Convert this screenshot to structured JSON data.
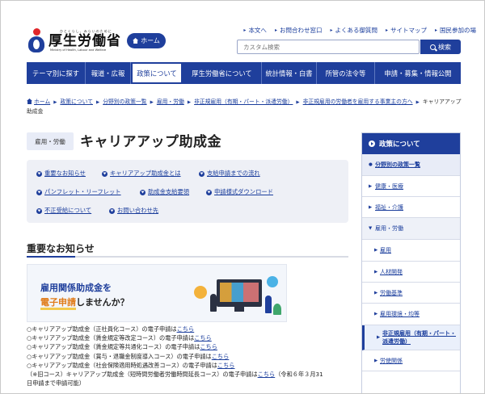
{
  "header": {
    "logo_ruby": "ひとくらし、みらいのために",
    "logo_name": "厚生労働省",
    "logo_en": "Ministry of Health, Labour and Welfare",
    "home_button": "ホーム",
    "top_links": [
      "本文へ",
      "お問合わせ窓口",
      "よくある御質問",
      "サイトマップ",
      "国民参加の場"
    ],
    "search_placeholder": "カスタム検索",
    "search_button": "検索"
  },
  "gnav": [
    "テーマ別に探す",
    "報道・広報",
    "政策について",
    "厚生労働省について",
    "統計情報・白書",
    "所管の法令等",
    "申請・募集・情報公開"
  ],
  "gnav_active_index": 2,
  "breadcrumb": [
    "ホーム",
    "政策について",
    "分野別の政策一覧",
    "雇用・労働",
    "非正規雇用（有期・パート・派遣労働）",
    "非正規雇用の労働者を雇用する事業主の方へ",
    "キャリアアップ助成金"
  ],
  "page": {
    "category": "雇用・労働",
    "title": "キャリアアップ助成金"
  },
  "anchors": [
    "重要なお知らせ",
    "キャリアアップ助成金とは",
    "支給申請までの流れ",
    "パンフレット・リーフレット",
    "助成金支給要領",
    "申請様式ダウンロード",
    "不正受給について",
    "お問い合わせ先"
  ],
  "section": {
    "title": "重要なお知らせ"
  },
  "banner": {
    "line1": "雇用関係助成金を",
    "line2_hl": "電子申請",
    "line2_rest": "しませんか？"
  },
  "notices": [
    {
      "text": "○キャリアアップ助成金（正社員化コース）の電子申請は",
      "link": "こちら",
      "after": ""
    },
    {
      "text": "○キャリアアップ助成金（賃金規定等改定コース）の電子申請は",
      "link": "こちら",
      "after": ""
    },
    {
      "text": "○キャリアアップ助成金（賃金規定等共通化コース）の電子申請は",
      "link": "こちら",
      "after": ""
    },
    {
      "text": "○キャリアアップ助成金（賞与・退職金制度導入コース）の電子申請は",
      "link": "こちら",
      "after": ""
    },
    {
      "text": "○キャリアアップ助成金（社会保険適用時処遇改善コース）の電子申請は",
      "link": "こちら",
      "after": ""
    },
    {
      "text": "（※旧コース）キャリアアップ助成金（短時間労働者労働時間延長コース）の電子申請は",
      "link": "こちら",
      "after": "（令和６年３月31"
    },
    {
      "text": "日申請まで申請可能）",
      "link": "",
      "after": ""
    }
  ],
  "sidebar": {
    "heading": "政策について",
    "items": [
      {
        "label": "分野別の政策一覧",
        "level": "lv0"
      },
      {
        "label": "健康・医療",
        "level": "lv1"
      },
      {
        "label": "福祉・介護",
        "level": "lv1"
      },
      {
        "label": "雇用・労働",
        "level": "lv1 open"
      },
      {
        "label": "雇用",
        "level": "lv2"
      },
      {
        "label": "人材開発",
        "level": "lv2"
      },
      {
        "label": "労働基準",
        "level": "lv2"
      },
      {
        "label": "雇用環境・均等",
        "level": "lv2"
      },
      {
        "label": "非正規雇用（有期・パート・派遣労働）",
        "level": "lv2 current"
      },
      {
        "label": "労使関係",
        "level": "lv2"
      }
    ]
  },
  "colors": {
    "brand_blue": "#1f3f9c",
    "brand_red": "#e0262a",
    "accent_orange": "#e07c1b"
  }
}
